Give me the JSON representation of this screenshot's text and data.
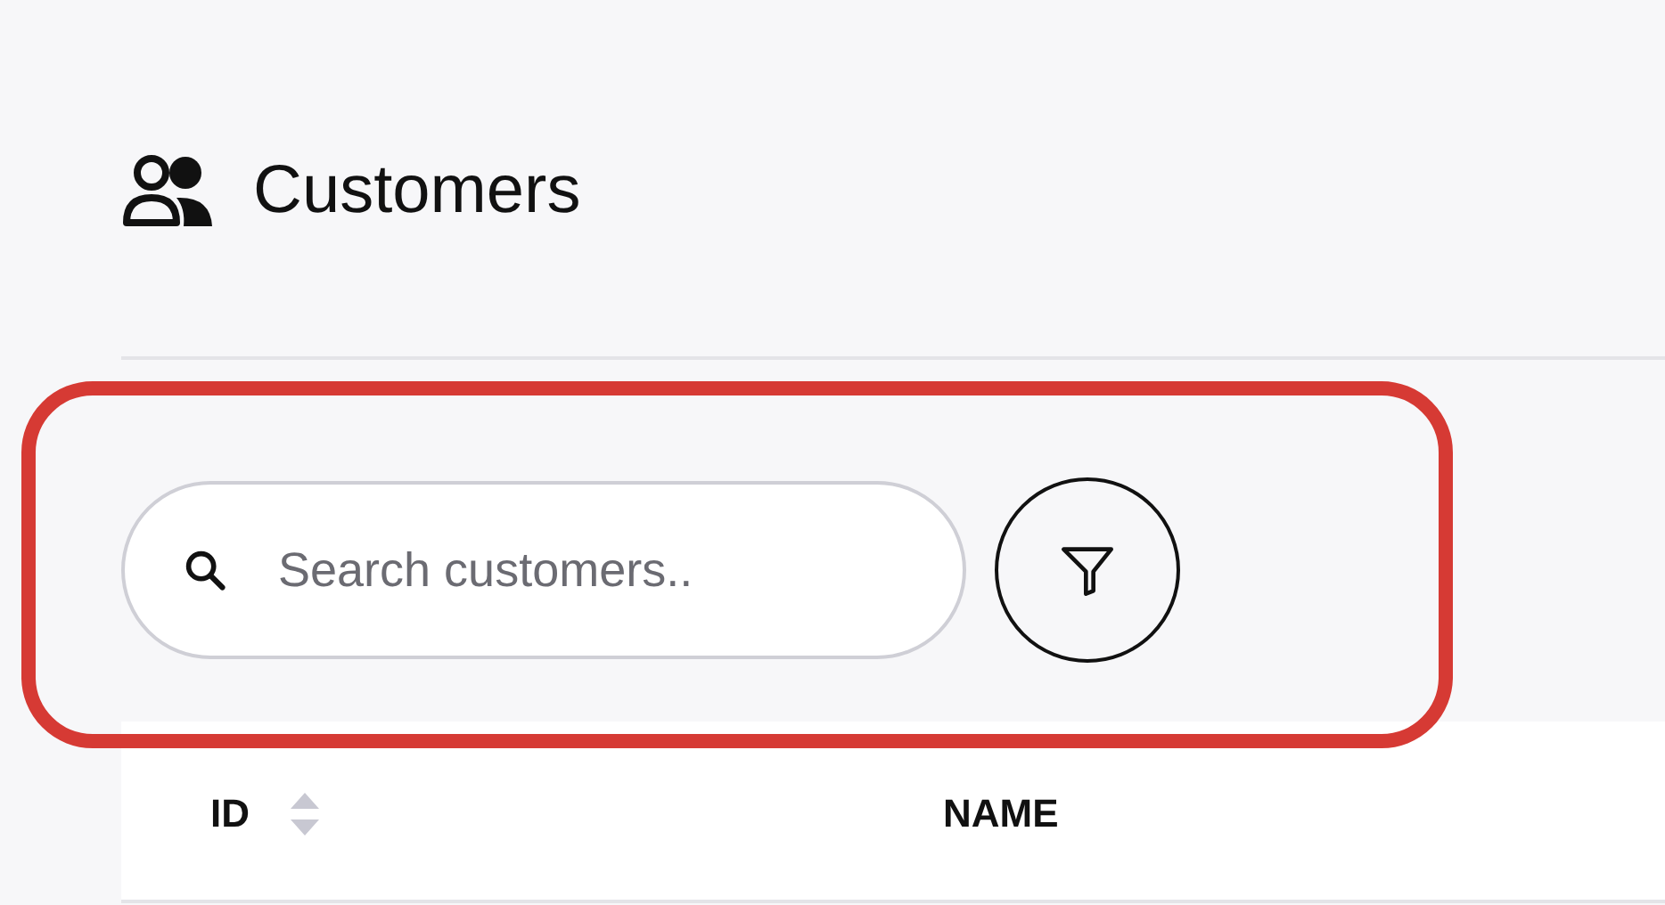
{
  "page": {
    "title": "Customers"
  },
  "toolbar": {
    "search": {
      "placeholder": "Search customers.."
    },
    "filter_button": {
      "kind": "filter"
    }
  },
  "annotation": {
    "kind": "highlight"
  },
  "table": {
    "columns": [
      {
        "label": "ID",
        "sortable": true
      },
      {
        "label": "NAME",
        "sortable": false
      }
    ]
  }
}
